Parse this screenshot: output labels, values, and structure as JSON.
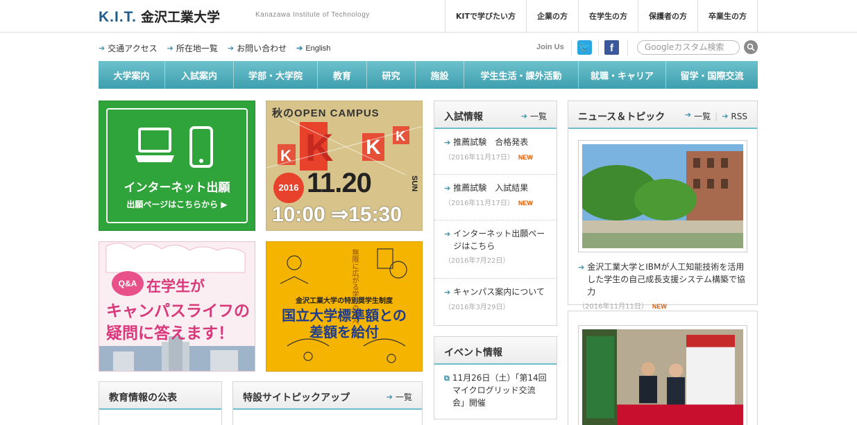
{
  "header": {
    "logo_kit": "K.I.T.",
    "logo_jp": "金沢工業大学",
    "tagline": "Kanazawa Institute of Technology",
    "nav": [
      "KITで学びたい方",
      "企業の方",
      "在学生の方",
      "保護者の方",
      "卒業生の方"
    ]
  },
  "utility": {
    "links": [
      "交通アクセス",
      "所在地一覧",
      "お問い合わせ",
      "English"
    ],
    "join_us": "Join Us",
    "search_placeholder": "Googleカスタム検索"
  },
  "main_nav": [
    "大学案内",
    "入試案内",
    "学部・大学院",
    "教育",
    "研究",
    "施設",
    "学生生活・課外活動",
    "就職・キャリア",
    "留学・国際交流"
  ],
  "banners": {
    "internet": {
      "line1": "インターネット出願",
      "line2": "出願ページはこちらから ▶"
    },
    "open_campus": {
      "title": "秋のOPEN CAMPUS",
      "year": "2016",
      "date": "11.20",
      "day": "SUN",
      "time": "10:00 ⇒15:30"
    },
    "qa": {
      "badge": "Q&A",
      "line1": "在学生が",
      "line2": "キャンパスライフの",
      "line3": "疑問に答えます！"
    },
    "scholarship": {
      "vertical": "無限に広がる学びの宝へ",
      "line1": "金沢工業大学の特別奨学生制度",
      "line2": "国立大学標準額との",
      "line3": "差額を給付"
    }
  },
  "admissions": {
    "title": "入試情報",
    "more": "一覧",
    "items": [
      {
        "text": "推薦試験　合格発表",
        "date": "（2016年11月17日）",
        "new": "NEW"
      },
      {
        "text": "推薦試験　入試結果",
        "date": "（2016年11月17日）",
        "new": "NEW"
      },
      {
        "text": "インターネット出願ページはこちら",
        "date": "（2016年7月22日）",
        "new": ""
      },
      {
        "text": "キャンパス案内について",
        "date": "（2016年3月29日）",
        "new": ""
      }
    ]
  },
  "events": {
    "title": "イベント情報",
    "items": [
      {
        "text": "11月26日（土）「第14回マイクログリッド交流会」開催"
      }
    ]
  },
  "news": {
    "title": "ニュース＆トピック",
    "more": "一覧",
    "rss": "RSS",
    "items": [
      {
        "text": "金沢工業大学とIBMが人工知能技術を活用した学生の自己成長支援システム構築で協力",
        "date": "（2016年11月11日）",
        "new": "NEW"
      }
    ]
  },
  "education_info": {
    "title": "教育情報の公表"
  },
  "special_site": {
    "title": "特設サイトピックアップ",
    "more": "一覧"
  },
  "colors": {
    "nav_teal": "#4aa9b6",
    "green": "#2ea43a",
    "accent_new": "#e05a00"
  }
}
